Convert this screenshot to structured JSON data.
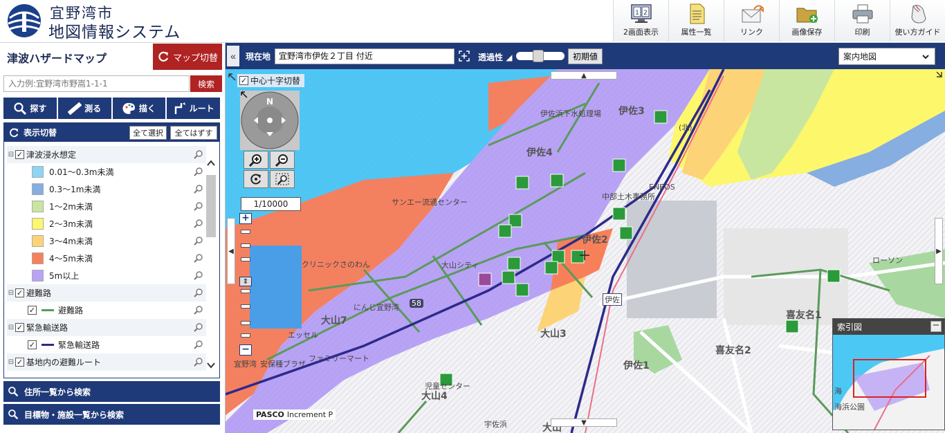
{
  "header": {
    "city": "宜野湾市",
    "system": "地図情報システム",
    "tools": [
      {
        "label": "2画面表示",
        "icon": "dual-screen-icon"
      },
      {
        "label": "属性一覧",
        "icon": "attribute-list-icon"
      },
      {
        "label": "リンク",
        "icon": "link-mail-icon"
      },
      {
        "label": "画像保存",
        "icon": "save-image-icon"
      },
      {
        "label": "印刷",
        "icon": "printer-icon"
      },
      {
        "label": "使い方ガイド",
        "icon": "mouse-guide-icon"
      }
    ]
  },
  "left": {
    "title": "津波ハザードマップ",
    "map_switch": "マップ切替",
    "search": {
      "placeholder": "入力例:宜野湾市野嵩1-1-1",
      "button": "検索"
    },
    "func_tabs": [
      "探す",
      "測る",
      "描く",
      "ルート"
    ],
    "display": {
      "title": "表示切替",
      "select_all": "全て選択",
      "deselect_all": "全てはずす",
      "groups": [
        {
          "label": "津波浸水想定",
          "checked": true
        },
        {
          "label": "避難路",
          "checked": true
        },
        {
          "label": "緊急輸送路",
          "checked": true
        },
        {
          "label": "基地内の避難ルート",
          "checked": true
        }
      ],
      "legend": [
        {
          "label": "0.01～0.3m未満",
          "color": "#8fd4f5"
        },
        {
          "label": "0.3～1m未満",
          "color": "#86aee0"
        },
        {
          "label": "1～2m未満",
          "color": "#c8e6a0"
        },
        {
          "label": "2～3m未満",
          "color": "#fdf76b"
        },
        {
          "label": "3～4m未満",
          "color": "#fcd477"
        },
        {
          "label": "4～5m未満",
          "color": "#f7805a"
        },
        {
          "label": "5m以上",
          "color": "#b9a3f5"
        }
      ],
      "evac_route": {
        "label": "避難路",
        "color": "#5a9a5a"
      },
      "emergency_route": {
        "label": "緊急輸送路",
        "color": "#2d2a8a"
      }
    },
    "sections": [
      "住所一覧から検索",
      "目標物・施設一覧から検索"
    ]
  },
  "mapbar": {
    "location_label": "現在地",
    "location_value": "宜野湾市伊佐２丁目 付近",
    "transparency_label": "透過性",
    "transparency": 0.45,
    "reset": "初期値",
    "basemap": "案内地図"
  },
  "map": {
    "crosshair_toggle": "中心十字切替",
    "compass": "N",
    "scale": "1/10000",
    "attribution": [
      "PASCO",
      "Increment P"
    ],
    "index_title": "索引図",
    "index_labels": [
      "海浜公園",
      "海"
    ],
    "labels": [
      {
        "text": "伊佐3"
      },
      {
        "text": "伊佐4"
      },
      {
        "text": "伊佐2"
      },
      {
        "text": "伊佐1"
      },
      {
        "text": "大山7"
      },
      {
        "text": "大山3"
      },
      {
        "text": "大山4"
      },
      {
        "text": "大山"
      },
      {
        "text": "喜友名1"
      },
      {
        "text": "喜友名2"
      },
      {
        "text": "宜野湾"
      }
    ],
    "small_labels": [
      {
        "text": "伊佐浜下水処理場"
      },
      {
        "text": "サンエー流通センター"
      },
      {
        "text": "大山シティ"
      },
      {
        "text": "にんじ宜野湾"
      },
      {
        "text": "中部土木事務所"
      },
      {
        "text": "ENEOS"
      },
      {
        "text": "ローソン"
      },
      {
        "text": "クリニックさのわん"
      },
      {
        "text": "エッセル"
      },
      {
        "text": "ファミリーマート"
      },
      {
        "text": "安保種ブラザ"
      },
      {
        "text": "児童センター"
      },
      {
        "text": "宇佐浜"
      },
      {
        "text": "伊佐"
      },
      {
        "text": "58"
      },
      {
        "text": "(北)"
      }
    ]
  }
}
